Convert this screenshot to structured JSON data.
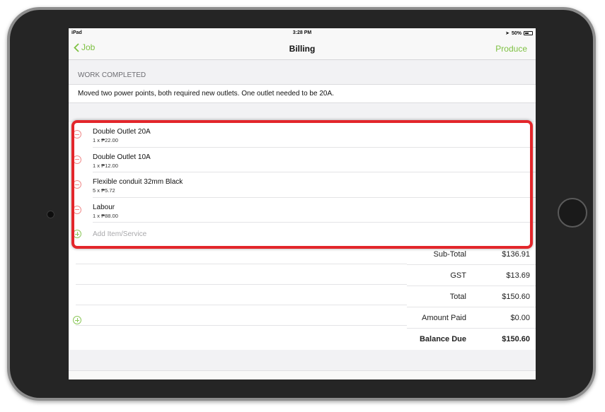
{
  "status_bar": {
    "device": "iPad",
    "time": "3:28 PM",
    "battery": "50%",
    "battery_level": 0.5
  },
  "nav": {
    "back_label": "Job",
    "title": "Billing",
    "action_label": "Produce"
  },
  "work_completed": {
    "header": "WORK COMPLETED",
    "description": "Moved two power points, both required new outlets. One outlet needed to be 20A."
  },
  "items": [
    {
      "name": "Double Outlet 20A",
      "detail": "1 x ₱22.00"
    },
    {
      "name": "Double Outlet 10A",
      "detail": "1 x ₱12.00"
    },
    {
      "name": "Flexible conduit 32mm Black",
      "detail": "5 x ₱5.72"
    },
    {
      "name": "Labour",
      "detail": "1 x ₱88.00"
    }
  ],
  "add_item_label": "Add Item/Service",
  "totals": {
    "subtotal_label": "Sub-Total",
    "subtotal": "$136.91",
    "gst_label": "GST",
    "gst": "$13.69",
    "total_label": "Total",
    "total": "$150.60",
    "paid_label": "Amount Paid",
    "paid": "$0.00",
    "balance_label": "Balance Due",
    "balance": "$150.60"
  },
  "colors": {
    "accent_green": "#7ec142",
    "remove_red": "#f08a8a",
    "highlight_red": "#e3262b"
  }
}
